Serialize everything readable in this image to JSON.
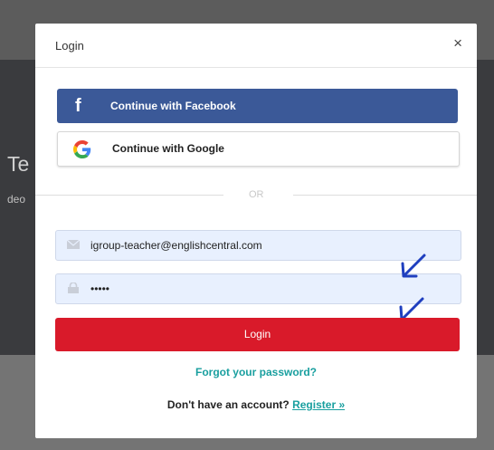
{
  "background": {
    "fragment_1": "Te",
    "fragment_2": "deo"
  },
  "modal": {
    "title": "Login",
    "close_label": "×"
  },
  "social": {
    "facebook_icon_glyph": "f",
    "facebook_label": "Continue with Facebook",
    "google_label": "Continue with Google"
  },
  "divider": {
    "label": "OR"
  },
  "form": {
    "email_value": "igroup-teacher@englishcentral.com",
    "password_value": "•••••",
    "submit_label": "Login"
  },
  "links": {
    "forgot_label": "Forgot your password?",
    "no_account_text": "Don't have an account? ",
    "register_label": "Register »"
  },
  "colors": {
    "facebook": "#3b5998",
    "login_button": "#d91a2a",
    "link": "#199f9f",
    "input_bg": "#e8f0fe",
    "annotation_arrow": "#1f3fbf"
  },
  "icons": {
    "email_field": "envelope-icon",
    "password_field": "lock-icon",
    "annotation": "arrow-down-left-icon"
  }
}
